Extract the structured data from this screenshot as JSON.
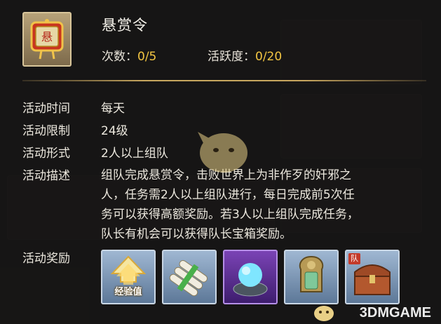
{
  "header": {
    "title": "悬赏令",
    "count_label": "次数：",
    "count_value": "0/5",
    "activity_label": "活跃度：",
    "activity_value": "0/20",
    "icon": "bounty-scroll-icon"
  },
  "details": {
    "time": {
      "label": "活动时间",
      "value": "每天"
    },
    "limit": {
      "label": "活动限制",
      "value": "24级"
    },
    "format": {
      "label": "活动形式",
      "value": "2人以上组队"
    },
    "description": {
      "label": "活动描述",
      "lines": [
        "组队完成悬赏令，击败世界上为非作歹的奸邪之",
        "人，任务需2人以上组队进行，每日完成前5次任",
        "务可以获得高额奖励。若3人以上组队完成任务，",
        "队长有机会可以获得队长宝箱奖励。"
      ]
    }
  },
  "rewards": {
    "label": "活动奖励",
    "items": [
      {
        "name": "experience",
        "text": "经验值",
        "icon": "experience-arrow-icon"
      },
      {
        "name": "scrolls",
        "icon": "scroll-bundle-icon"
      },
      {
        "name": "orb",
        "icon": "spirit-orb-icon"
      },
      {
        "name": "token",
        "icon": "jade-token-icon"
      },
      {
        "name": "captain-chest",
        "tag": "队",
        "icon": "treasure-chest-icon"
      }
    ]
  },
  "watermark": "3DMGAME",
  "colors": {
    "accent": "#f2c542",
    "divider": "#c7a65e",
    "text": "#ece8de"
  }
}
